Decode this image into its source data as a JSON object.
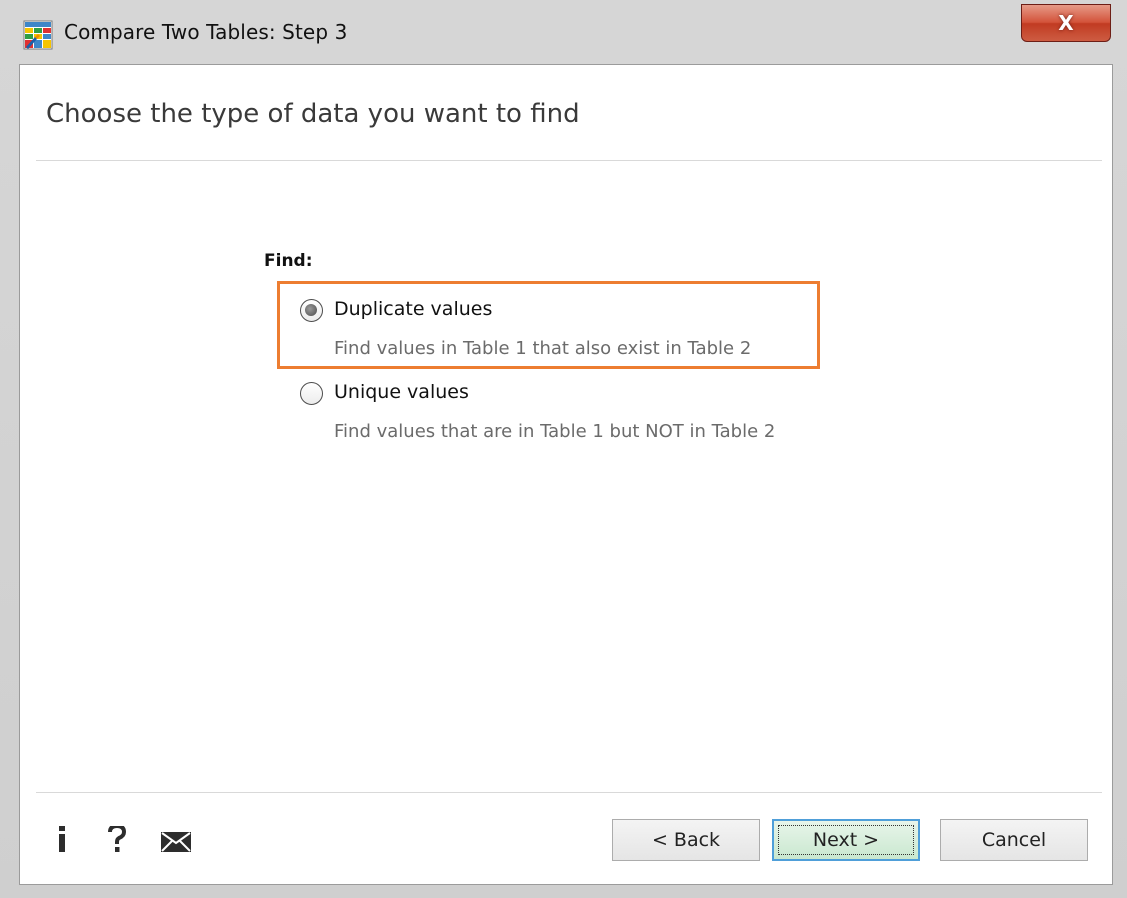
{
  "window": {
    "title": "Compare Two Tables: Step 3",
    "close_label": "X"
  },
  "main": {
    "heading": "Choose the type of data you want to find",
    "find_label": "Find:",
    "options": [
      {
        "label": "Duplicate values",
        "description": "Find values in Table 1 that also exist in Table 2",
        "selected": true
      },
      {
        "label": "Unique values",
        "description": "Find values that are in Table 1 but NOT in Table 2",
        "selected": false
      }
    ]
  },
  "footer": {
    "icons": [
      "info-icon",
      "help-icon",
      "mail-icon"
    ],
    "back_label": "< Back",
    "next_label": "Next >",
    "cancel_label": "Cancel"
  },
  "colors": {
    "highlight": "#ed7d31",
    "default_button_border": "#4f9fd9",
    "close_button": "#c13b22"
  }
}
